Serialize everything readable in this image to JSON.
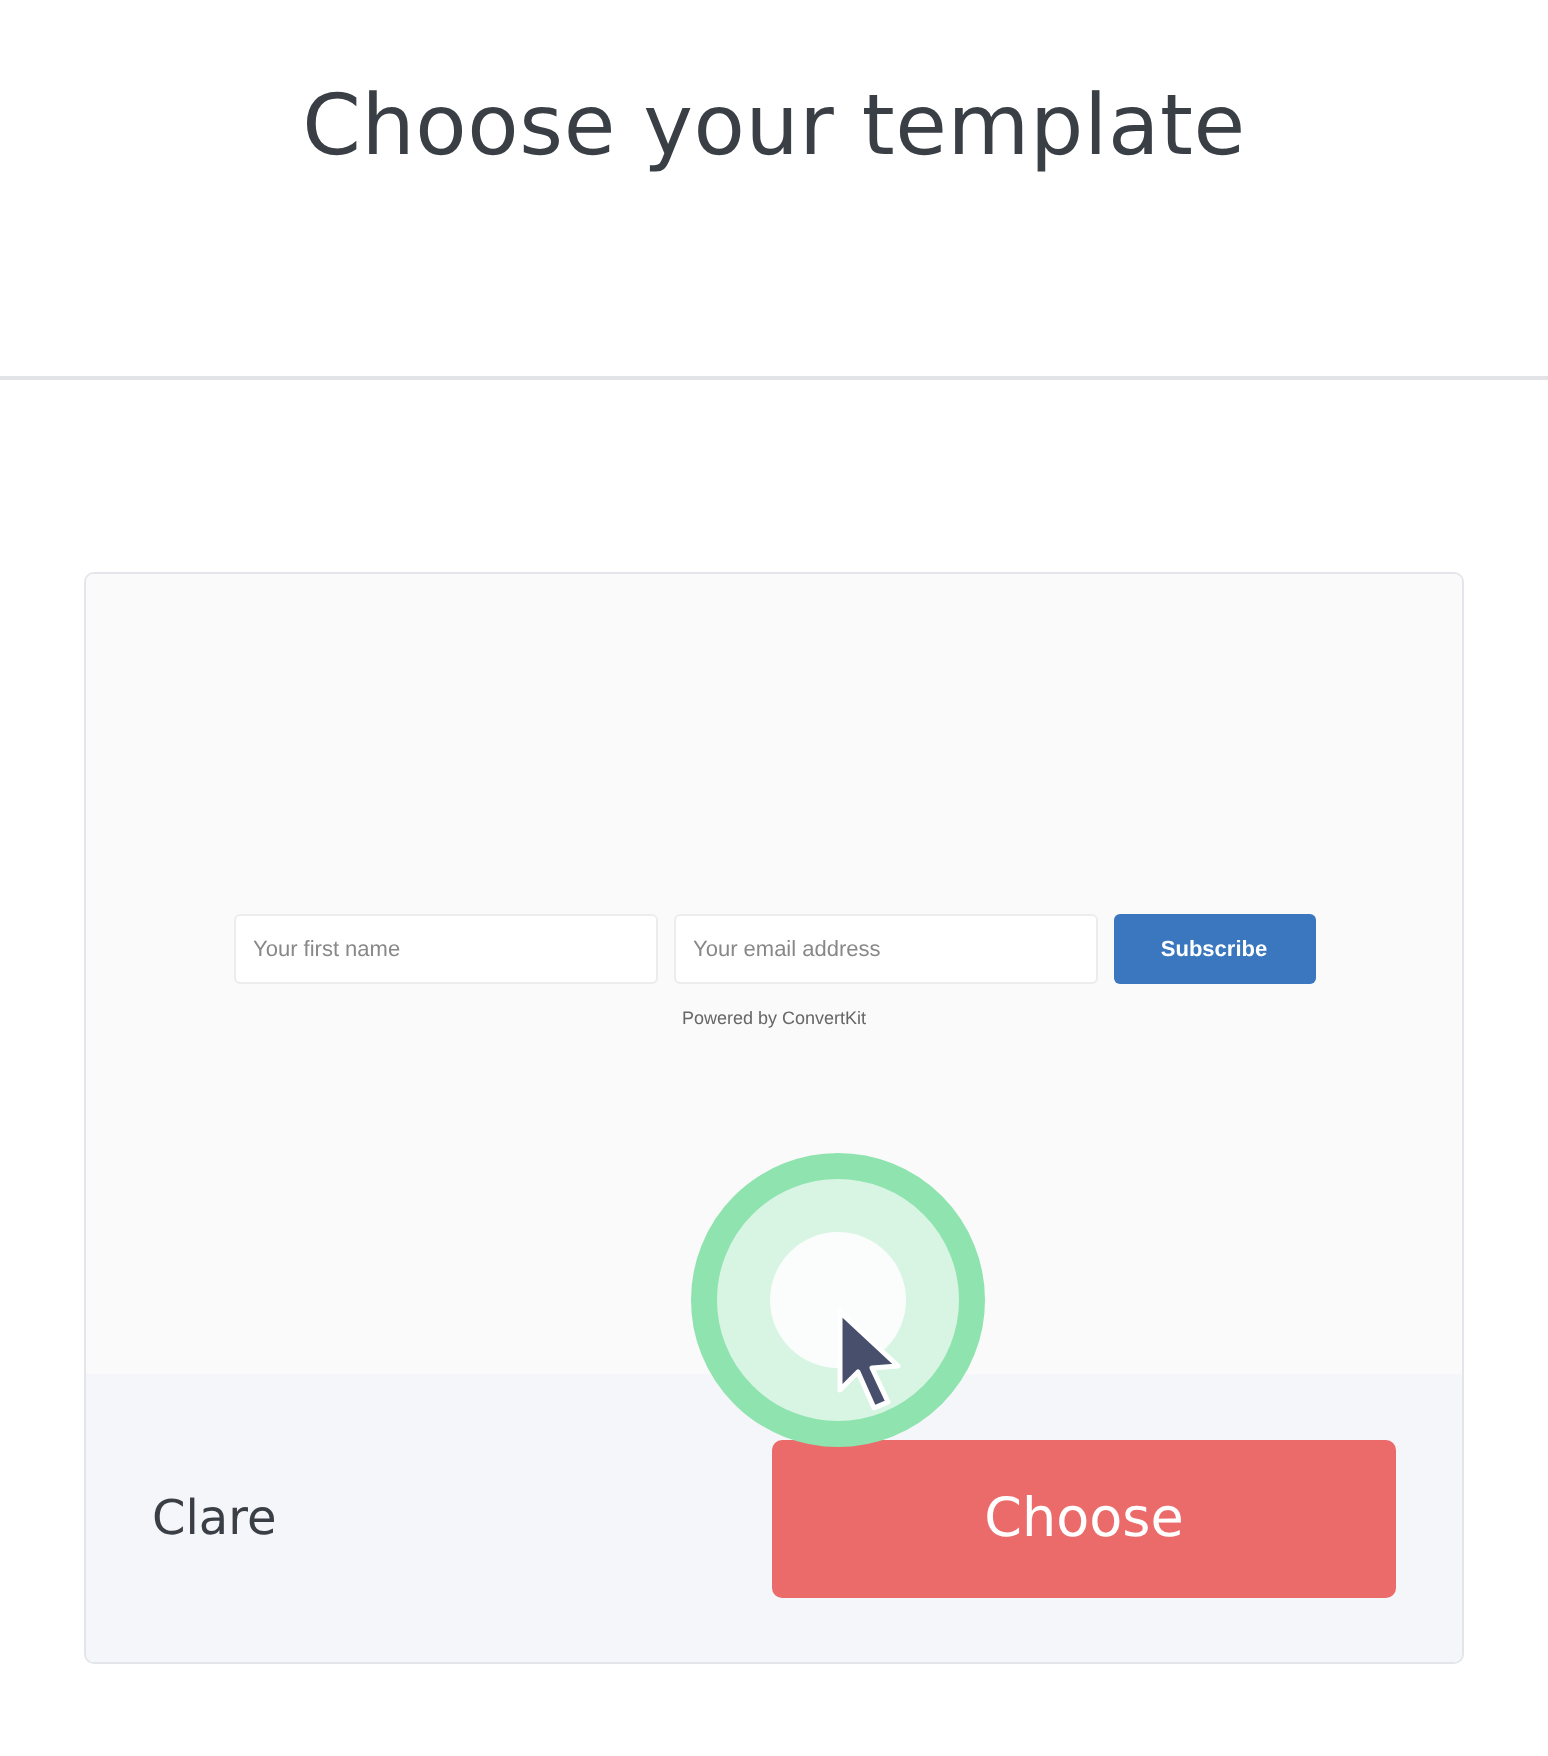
{
  "heading": "Choose your template",
  "template": {
    "form": {
      "fields": [
        {
          "placeholder": "Your first name"
        },
        {
          "placeholder": "Your email address"
        }
      ],
      "button": "Subscribe",
      "powered_by": "Powered by ConvertKit"
    },
    "name": "Clare",
    "action": "Choose"
  }
}
